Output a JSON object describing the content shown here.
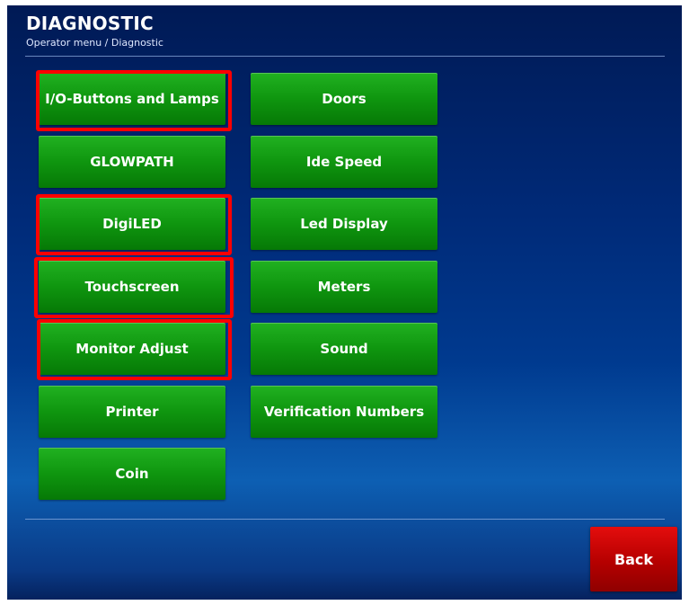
{
  "header": {
    "title": "DIAGNOSTIC",
    "subtitle": "Operator menu / Diagnostic"
  },
  "buttons": {
    "io_buttons_lamps": "I/O-Buttons and Lamps",
    "glowpath": "GLOWPATH",
    "digiled": "DigiLED",
    "touchscreen": "Touchscreen",
    "monitor_adjust": "Monitor Adjust",
    "printer": "Printer",
    "coin": "Coin",
    "doors": "Doors",
    "ide_speed": "Ide Speed",
    "led_display": "Led Display",
    "meters": "Meters",
    "sound": "Sound",
    "verification_numbers": "Verification Numbers"
  },
  "back_label": "Back",
  "colors": {
    "button_green": "#0f960f",
    "back_red": "#c10000",
    "highlight": "#ff0000",
    "background_blue": "#002a78"
  }
}
